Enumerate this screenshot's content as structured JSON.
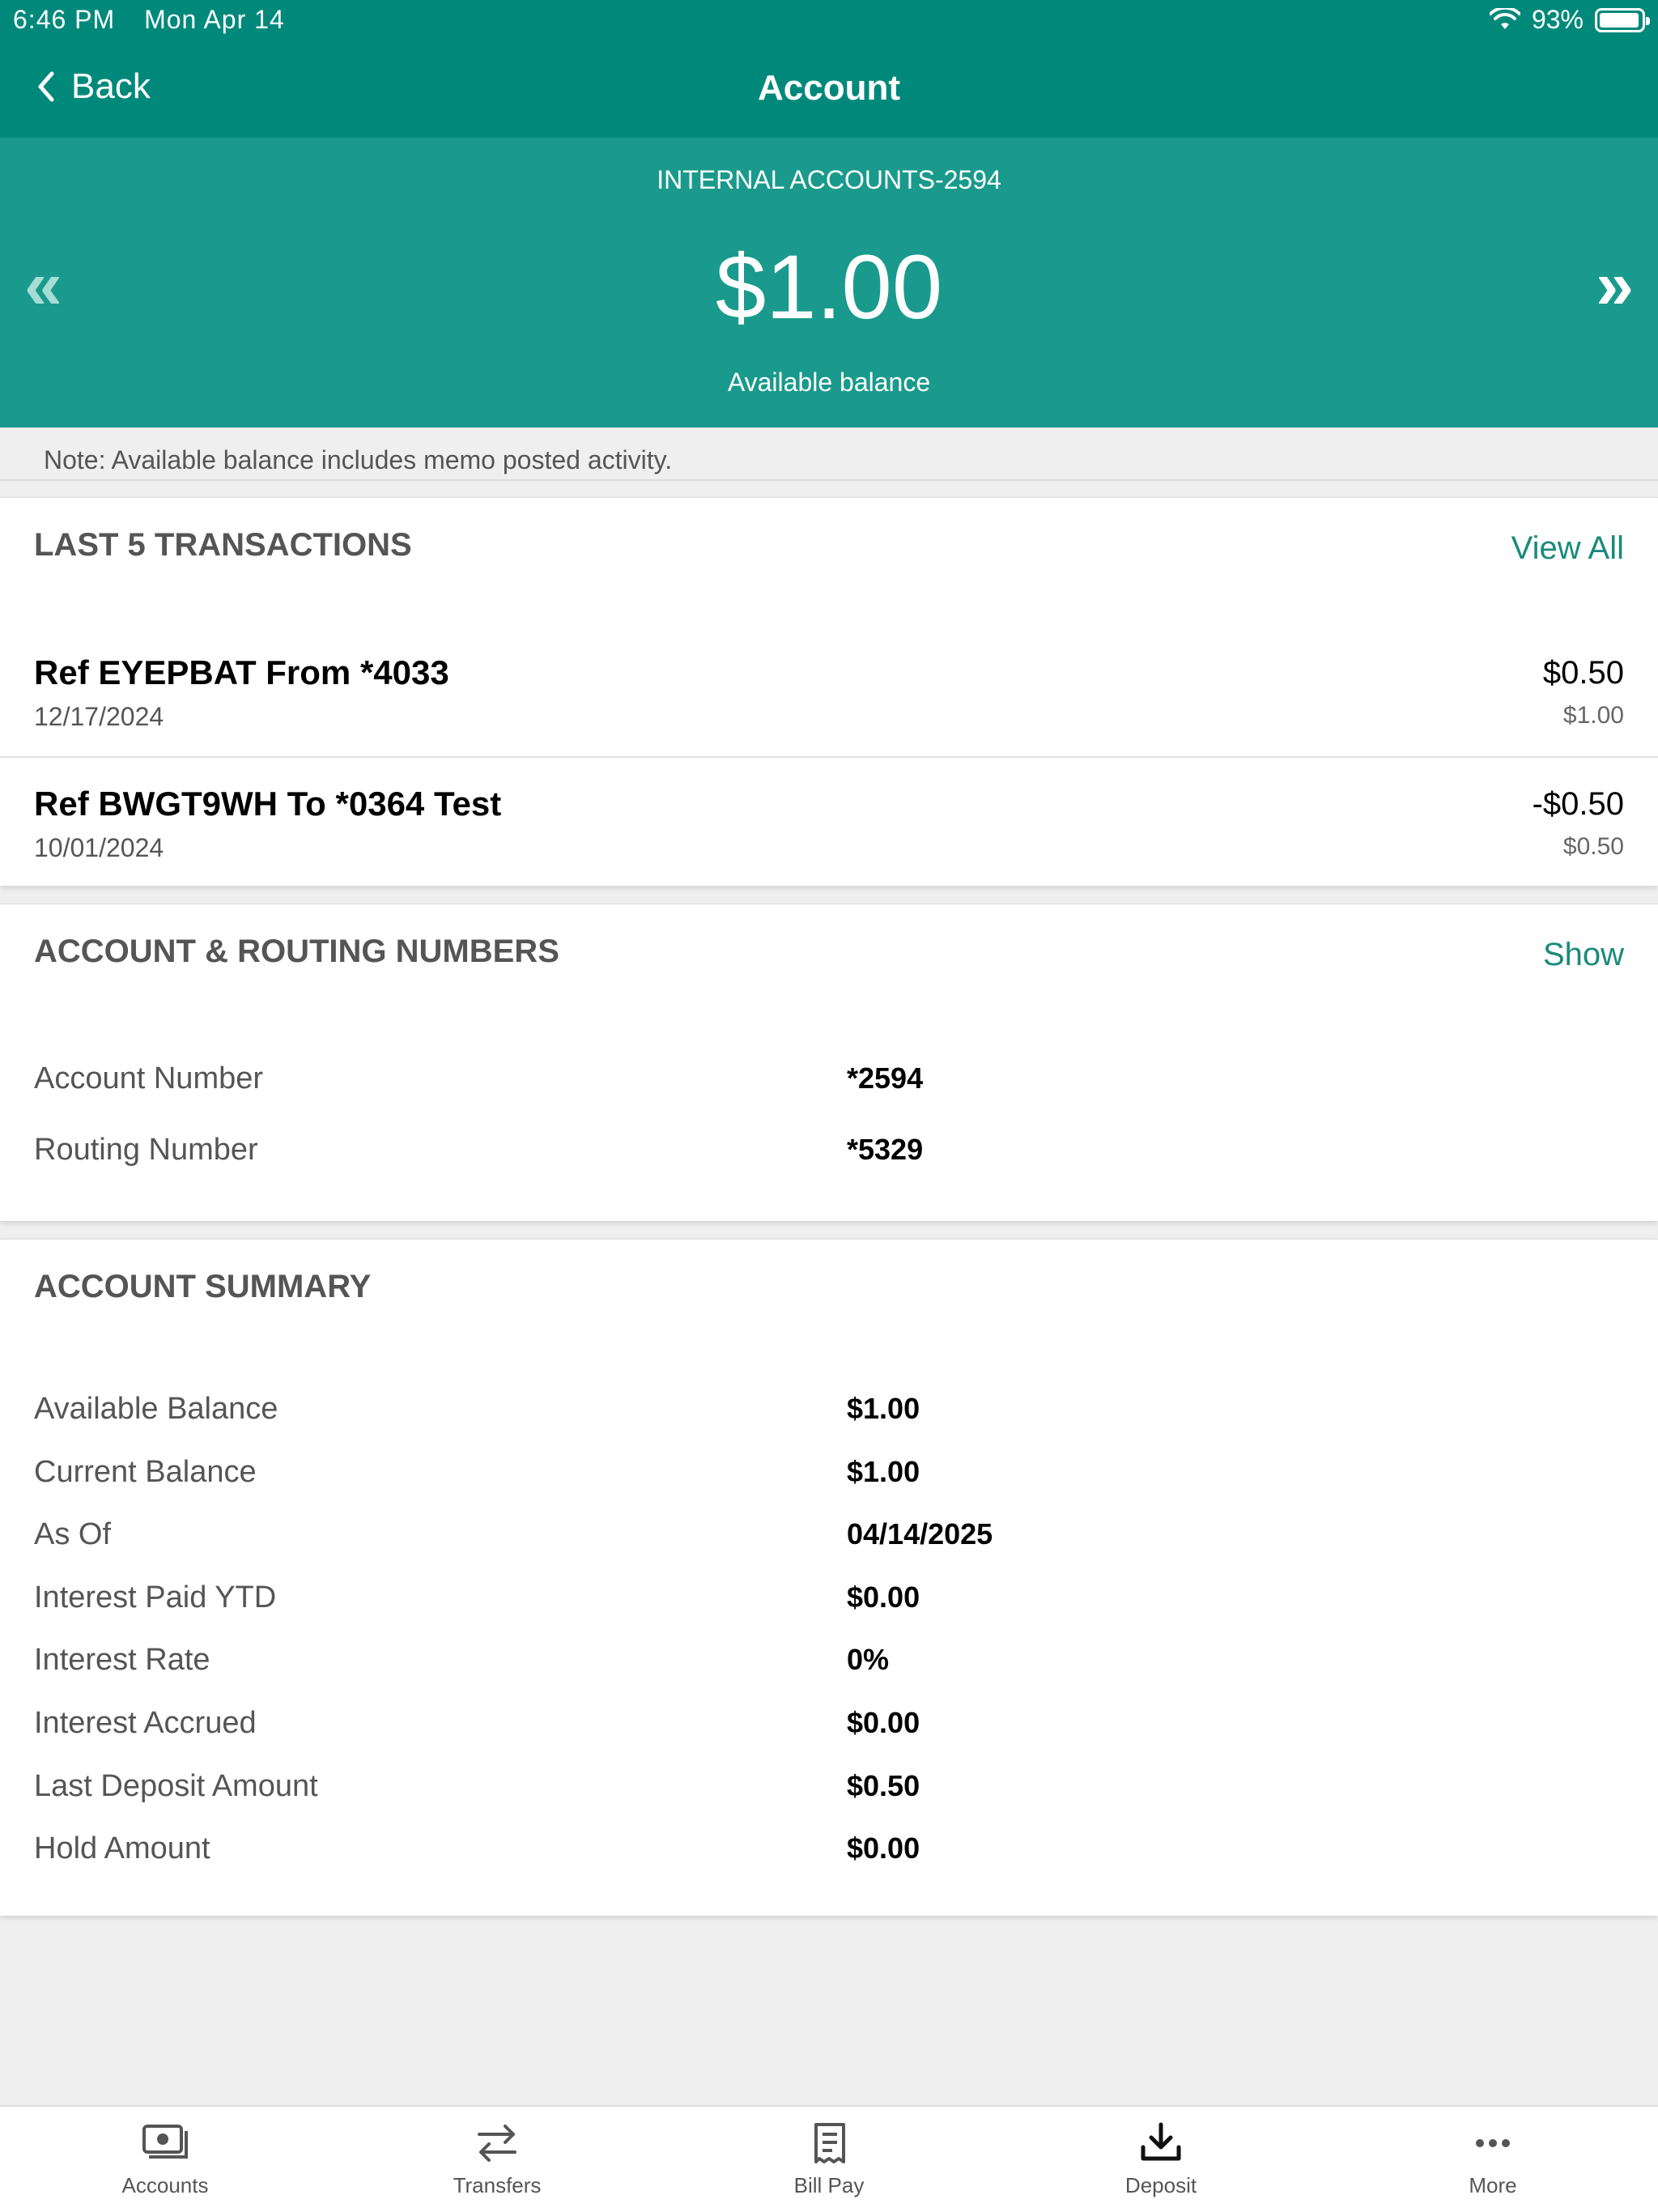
{
  "status_bar": {
    "time": "6:46 PM",
    "date": "Mon Apr 14",
    "battery": "93%"
  },
  "nav": {
    "back_label": "Back",
    "title": "Account"
  },
  "account": {
    "name": "INTERNAL ACCOUNTS-2594",
    "balance": "$1.00",
    "balance_label": "Available balance",
    "prev_glyph": "«",
    "next_glyph": "»"
  },
  "note": "Note: Available balance includes memo posted activity.",
  "transactions": {
    "title": "LAST 5 TRANSACTIONS",
    "view_all": "View All",
    "items": [
      {
        "name": "Ref EYEPBAT From *4033",
        "date": "12/17/2024",
        "amount": "$0.50",
        "running_balance": "$1.00"
      },
      {
        "name": "Ref BWGT9WH To *0364 Test",
        "date": "10/01/2024",
        "amount": "-$0.50",
        "running_balance": "$0.50"
      }
    ]
  },
  "routing": {
    "title": "ACCOUNT & ROUTING NUMBERS",
    "show_label": "Show",
    "rows": [
      {
        "label": "Account Number",
        "value": "*2594"
      },
      {
        "label": "Routing Number",
        "value": "*5329"
      }
    ]
  },
  "summary": {
    "title": "ACCOUNT SUMMARY",
    "rows": [
      {
        "label": "Available Balance",
        "value": "$1.00"
      },
      {
        "label": "Current Balance",
        "value": "$1.00"
      },
      {
        "label": "As Of",
        "value": "04/14/2025"
      },
      {
        "label": "Interest Paid YTD",
        "value": "$0.00"
      },
      {
        "label": "Interest Rate",
        "value": "0%"
      },
      {
        "label": "Interest Accrued",
        "value": "$0.00"
      },
      {
        "label": "Last Deposit Amount",
        "value": "$0.50"
      },
      {
        "label": "Hold Amount",
        "value": "$0.00"
      }
    ]
  },
  "tabs": [
    {
      "label": "Accounts",
      "icon": "accounts-icon"
    },
    {
      "label": "Transfers",
      "icon": "transfers-icon"
    },
    {
      "label": "Bill Pay",
      "icon": "bill-pay-icon"
    },
    {
      "label": "Deposit",
      "icon": "deposit-icon"
    },
    {
      "label": "More",
      "icon": "more-icon"
    }
  ],
  "colors": {
    "header": "#00897b",
    "band": "#1a9a8c",
    "link": "#1a8a7c"
  }
}
